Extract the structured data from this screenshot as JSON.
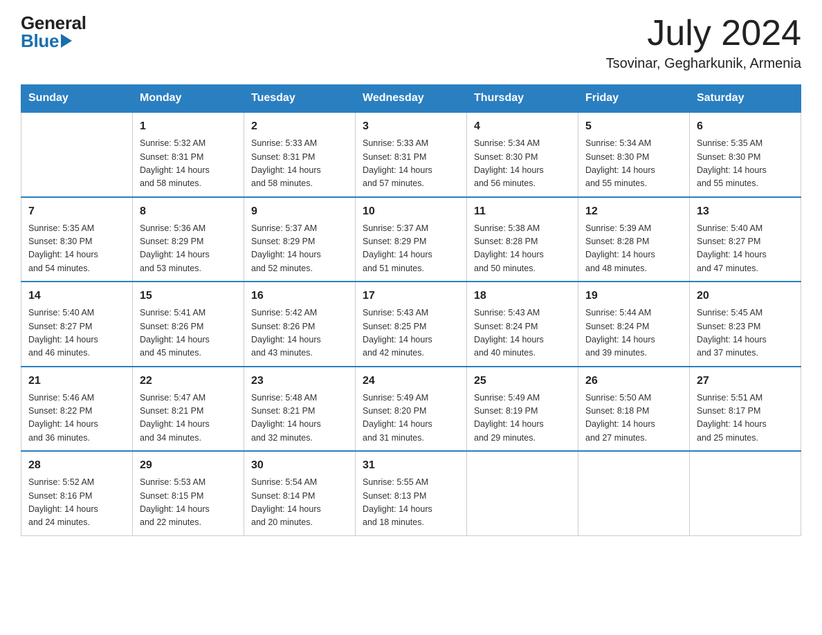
{
  "header": {
    "logo_general": "General",
    "logo_blue": "Blue",
    "month_year": "July 2024",
    "location": "Tsovinar, Gegharkunik, Armenia"
  },
  "days_of_week": [
    "Sunday",
    "Monday",
    "Tuesday",
    "Wednesday",
    "Thursday",
    "Friday",
    "Saturday"
  ],
  "weeks": [
    [
      {
        "day": "",
        "info": ""
      },
      {
        "day": "1",
        "info": "Sunrise: 5:32 AM\nSunset: 8:31 PM\nDaylight: 14 hours\nand 58 minutes."
      },
      {
        "day": "2",
        "info": "Sunrise: 5:33 AM\nSunset: 8:31 PM\nDaylight: 14 hours\nand 58 minutes."
      },
      {
        "day": "3",
        "info": "Sunrise: 5:33 AM\nSunset: 8:31 PM\nDaylight: 14 hours\nand 57 minutes."
      },
      {
        "day": "4",
        "info": "Sunrise: 5:34 AM\nSunset: 8:30 PM\nDaylight: 14 hours\nand 56 minutes."
      },
      {
        "day": "5",
        "info": "Sunrise: 5:34 AM\nSunset: 8:30 PM\nDaylight: 14 hours\nand 55 minutes."
      },
      {
        "day": "6",
        "info": "Sunrise: 5:35 AM\nSunset: 8:30 PM\nDaylight: 14 hours\nand 55 minutes."
      }
    ],
    [
      {
        "day": "7",
        "info": "Sunrise: 5:35 AM\nSunset: 8:30 PM\nDaylight: 14 hours\nand 54 minutes."
      },
      {
        "day": "8",
        "info": "Sunrise: 5:36 AM\nSunset: 8:29 PM\nDaylight: 14 hours\nand 53 minutes."
      },
      {
        "day": "9",
        "info": "Sunrise: 5:37 AM\nSunset: 8:29 PM\nDaylight: 14 hours\nand 52 minutes."
      },
      {
        "day": "10",
        "info": "Sunrise: 5:37 AM\nSunset: 8:29 PM\nDaylight: 14 hours\nand 51 minutes."
      },
      {
        "day": "11",
        "info": "Sunrise: 5:38 AM\nSunset: 8:28 PM\nDaylight: 14 hours\nand 50 minutes."
      },
      {
        "day": "12",
        "info": "Sunrise: 5:39 AM\nSunset: 8:28 PM\nDaylight: 14 hours\nand 48 minutes."
      },
      {
        "day": "13",
        "info": "Sunrise: 5:40 AM\nSunset: 8:27 PM\nDaylight: 14 hours\nand 47 minutes."
      }
    ],
    [
      {
        "day": "14",
        "info": "Sunrise: 5:40 AM\nSunset: 8:27 PM\nDaylight: 14 hours\nand 46 minutes."
      },
      {
        "day": "15",
        "info": "Sunrise: 5:41 AM\nSunset: 8:26 PM\nDaylight: 14 hours\nand 45 minutes."
      },
      {
        "day": "16",
        "info": "Sunrise: 5:42 AM\nSunset: 8:26 PM\nDaylight: 14 hours\nand 43 minutes."
      },
      {
        "day": "17",
        "info": "Sunrise: 5:43 AM\nSunset: 8:25 PM\nDaylight: 14 hours\nand 42 minutes."
      },
      {
        "day": "18",
        "info": "Sunrise: 5:43 AM\nSunset: 8:24 PM\nDaylight: 14 hours\nand 40 minutes."
      },
      {
        "day": "19",
        "info": "Sunrise: 5:44 AM\nSunset: 8:24 PM\nDaylight: 14 hours\nand 39 minutes."
      },
      {
        "day": "20",
        "info": "Sunrise: 5:45 AM\nSunset: 8:23 PM\nDaylight: 14 hours\nand 37 minutes."
      }
    ],
    [
      {
        "day": "21",
        "info": "Sunrise: 5:46 AM\nSunset: 8:22 PM\nDaylight: 14 hours\nand 36 minutes."
      },
      {
        "day": "22",
        "info": "Sunrise: 5:47 AM\nSunset: 8:21 PM\nDaylight: 14 hours\nand 34 minutes."
      },
      {
        "day": "23",
        "info": "Sunrise: 5:48 AM\nSunset: 8:21 PM\nDaylight: 14 hours\nand 32 minutes."
      },
      {
        "day": "24",
        "info": "Sunrise: 5:49 AM\nSunset: 8:20 PM\nDaylight: 14 hours\nand 31 minutes."
      },
      {
        "day": "25",
        "info": "Sunrise: 5:49 AM\nSunset: 8:19 PM\nDaylight: 14 hours\nand 29 minutes."
      },
      {
        "day": "26",
        "info": "Sunrise: 5:50 AM\nSunset: 8:18 PM\nDaylight: 14 hours\nand 27 minutes."
      },
      {
        "day": "27",
        "info": "Sunrise: 5:51 AM\nSunset: 8:17 PM\nDaylight: 14 hours\nand 25 minutes."
      }
    ],
    [
      {
        "day": "28",
        "info": "Sunrise: 5:52 AM\nSunset: 8:16 PM\nDaylight: 14 hours\nand 24 minutes."
      },
      {
        "day": "29",
        "info": "Sunrise: 5:53 AM\nSunset: 8:15 PM\nDaylight: 14 hours\nand 22 minutes."
      },
      {
        "day": "30",
        "info": "Sunrise: 5:54 AM\nSunset: 8:14 PM\nDaylight: 14 hours\nand 20 minutes."
      },
      {
        "day": "31",
        "info": "Sunrise: 5:55 AM\nSunset: 8:13 PM\nDaylight: 14 hours\nand 18 minutes."
      },
      {
        "day": "",
        "info": ""
      },
      {
        "day": "",
        "info": ""
      },
      {
        "day": "",
        "info": ""
      }
    ]
  ]
}
